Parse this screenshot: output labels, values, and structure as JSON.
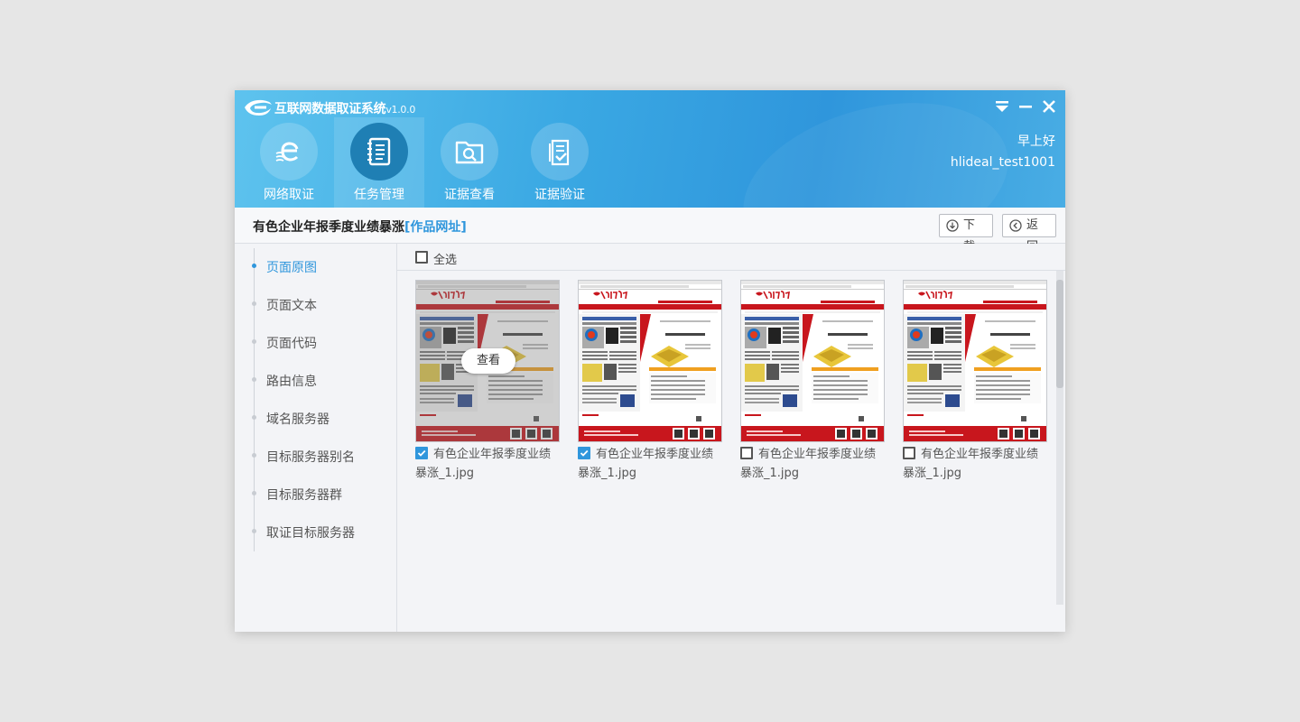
{
  "app": {
    "title": "互联网数据取证系统",
    "version": "v1.0.0",
    "greeting": "早上好",
    "username": "hlideal_test1001"
  },
  "nav": [
    {
      "label": "网络取证",
      "icon": "e-capture-icon",
      "active": false
    },
    {
      "label": "任务管理",
      "icon": "notebook-icon",
      "active": true
    },
    {
      "label": "证据查看",
      "icon": "folder-search-icon",
      "active": false
    },
    {
      "label": "证据验证",
      "icon": "document-check-icon",
      "active": false
    }
  ],
  "task": {
    "title": "有色企业年报季度业绩暴涨",
    "link_label": "[作品网址]"
  },
  "toolbar": {
    "download_label": "下载",
    "back_label": "返回"
  },
  "sidebar": {
    "items": [
      {
        "label": "页面原图",
        "active": true
      },
      {
        "label": "页面文本",
        "active": false
      },
      {
        "label": "页面代码",
        "active": false
      },
      {
        "label": "路由信息",
        "active": false
      },
      {
        "label": "域名服务器",
        "active": false
      },
      {
        "label": "目标服务器别名",
        "active": false
      },
      {
        "label": "目标服务器群",
        "active": false
      },
      {
        "label": "取证目标服务器",
        "active": false
      }
    ]
  },
  "gallery": {
    "select_all_label": "全选",
    "select_all_checked": false,
    "view_label": "查看",
    "items": [
      {
        "filename": "有色企业年报季度业绩暴涨_1.jpg",
        "checked": true,
        "hovered": true
      },
      {
        "filename": "有色企业年报季度业绩暴涨_1.jpg",
        "checked": true,
        "hovered": false
      },
      {
        "filename": "有色企业年报季度业绩暴涨_1.jpg",
        "checked": false,
        "hovered": false
      },
      {
        "filename": "有色企业年报季度业绩暴涨_1.jpg",
        "checked": false,
        "hovered": false
      }
    ]
  },
  "colors": {
    "accent": "#2f96dc",
    "header_start": "#5ec3ee",
    "newspaper_red": "#c8161d"
  }
}
